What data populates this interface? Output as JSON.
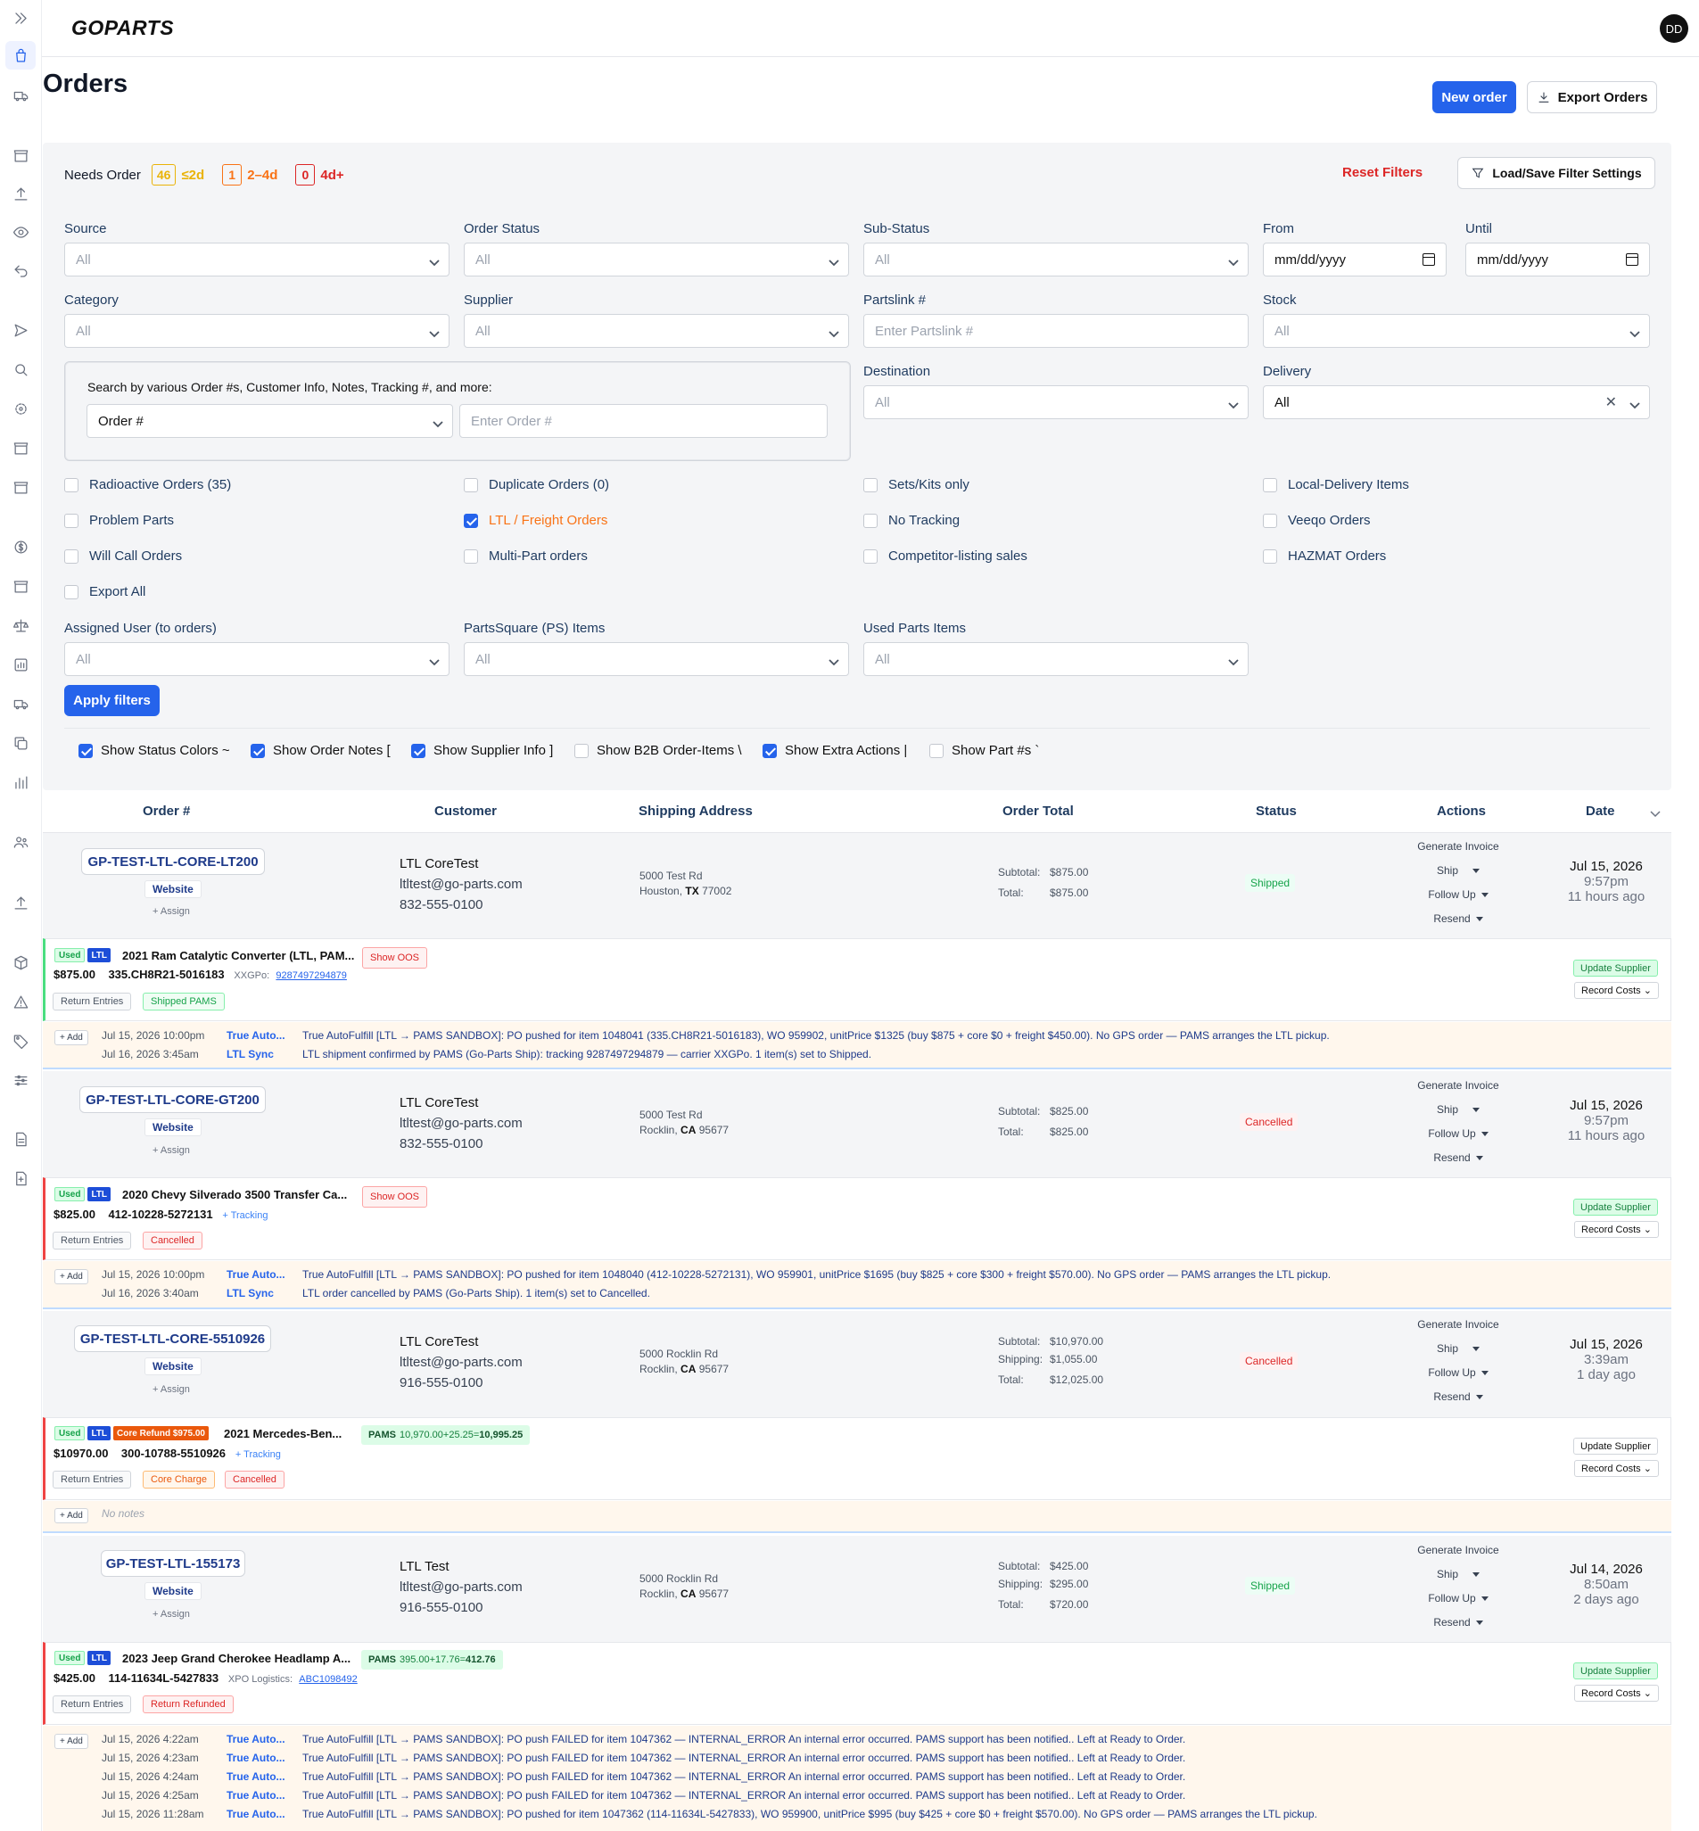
{
  "app": {
    "logo": "GOPARTS",
    "avatar_initials": "DD"
  },
  "page": {
    "title": "Orders",
    "new_order": "New order",
    "export_orders": "Export Orders"
  },
  "needs_order": {
    "label": "Needs Order",
    "counts": [
      {
        "count": "46",
        "range": "≤2d",
        "color": "#eab308"
      },
      {
        "count": "1",
        "range": "2–4d",
        "color": "#f97316"
      },
      {
        "count": "0",
        "range": "4d+",
        "color": "#dc2626"
      }
    ]
  },
  "filters": {
    "reset": "Reset Filters",
    "load_save": "Load/Save Filter Settings",
    "source": {
      "label": "Source",
      "value": "All"
    },
    "order_status": {
      "label": "Order Status",
      "value": "All"
    },
    "sub_status": {
      "label": "Sub-Status",
      "value": "All"
    },
    "from": {
      "label": "From",
      "value": "mm/dd/yyyy"
    },
    "until": {
      "label": "Until",
      "value": "mm/dd/yyyy"
    },
    "category": {
      "label": "Category",
      "value": "All"
    },
    "supplier": {
      "label": "Supplier",
      "value": "All"
    },
    "partslink": {
      "label": "Partslink #",
      "placeholder": "Enter Partslink #"
    },
    "stock": {
      "label": "Stock",
      "value": "All"
    },
    "search": {
      "label": "Search by various Order #s, Customer Info, Notes, Tracking #, and more:",
      "type": "Order #",
      "placeholder": "Enter Order #"
    },
    "destination": {
      "label": "Destination",
      "value": "All"
    },
    "delivery": {
      "label": "Delivery",
      "value": "All"
    },
    "checkboxes": [
      {
        "label": "Radioactive Orders (35)",
        "checked": false
      },
      {
        "label": "Duplicate Orders (0)",
        "checked": false
      },
      {
        "label": "Sets/Kits only",
        "checked": false
      },
      {
        "label": "Local-Delivery Items",
        "checked": false
      },
      {
        "label": "Problem Parts",
        "checked": false
      },
      {
        "label": "LTL / Freight Orders",
        "checked": true
      },
      {
        "label": "No Tracking",
        "checked": false
      },
      {
        "label": "Veeqo Orders",
        "checked": false
      },
      {
        "label": "Will Call Orders",
        "checked": false
      },
      {
        "label": "Multi-Part orders",
        "checked": false
      },
      {
        "label": "Competitor-listing sales",
        "checked": false
      },
      {
        "label": "HAZMAT Orders",
        "checked": false
      },
      {
        "label": "Export All",
        "checked": false
      }
    ],
    "assigned_user": {
      "label": "Assigned User (to orders)",
      "value": "All"
    },
    "partssquare": {
      "label": "PartsSquare (PS) Items",
      "value": "All"
    },
    "used_parts": {
      "label": "Used Parts Items",
      "value": "All"
    },
    "apply": "Apply filters"
  },
  "toggles": [
    {
      "label": "Show Status Colors ~",
      "checked": true
    },
    {
      "label": "Show Order Notes [",
      "checked": true
    },
    {
      "label": "Show Supplier Info ]",
      "checked": true
    },
    {
      "label": "Show B2B Order-Items \\",
      "checked": false
    },
    {
      "label": "Show Extra Actions |",
      "checked": true
    },
    {
      "label": "Show Part #s `",
      "checked": false
    }
  ],
  "table": {
    "headers": [
      "Order #",
      "Customer",
      "Shipping Address",
      "Order Total",
      "Status",
      "Actions",
      "Date"
    ]
  },
  "actions": {
    "generate_invoice": "Generate Invoice",
    "ship": "Ship",
    "follow_up": "Follow Up",
    "resend": "Resend",
    "assign": "+ Assign",
    "return_entries": "Return Entries",
    "update_supplier": "Update Supplier",
    "record_costs": "Record Costs ⌄",
    "add": "+ Add",
    "show_oos": "Show OOS",
    "tracking": "+ Tracking",
    "used": "Used",
    "ltl": "LTL",
    "subtotal": "Subtotal:",
    "shipping": "Shipping:",
    "total": "Total:",
    "no_notes": "No notes"
  },
  "orders": [
    {
      "number": "GP-TEST-LTL-CORE-LT200",
      "source": "Website",
      "customer": "LTL CoreTest",
      "email": "ltltest@go-parts.com",
      "phone": "832-555-0100",
      "addr1": "5000 Test Rd",
      "city": "Houston,",
      "state": "TX",
      "zip": "77002",
      "subtotal": "$875.00",
      "total": "$875.00",
      "status": "Shipped",
      "date": "Jul 15, 2026",
      "time": "9:57pm",
      "ago": "11 hours ago",
      "item_title": "2021 Ram Catalytic Converter (LTL, PAM...",
      "price": "$875.00",
      "part": "335.CH8R21-5016183",
      "carrier": "XXGPo:",
      "tracking_no": "9287497294879",
      "chip": "Shipped PAMS",
      "notes": [
        {
          "date": "Jul 15, 2026  10:00pm",
          "author": "True Auto...",
          "text": "True AutoFulfill [LTL → PAMS SANDBOX]: PO pushed for item 1048041 (335.CH8R21-5016183), WO 959902, unitPrice $1325 (buy $875 + core $0 + freight $450.00). No GPS order — PAMS arranges the LTL pickup."
        },
        {
          "date": "Jul 16, 2026  3:45am",
          "author": "LTL Sync",
          "text": "LTL shipment confirmed by PAMS (Go-Parts Ship): tracking 9287497294879 — carrier XXGPo. 1 item(s) set to Shipped."
        }
      ]
    },
    {
      "number": "GP-TEST-LTL-CORE-GT200",
      "source": "Website",
      "customer": "LTL CoreTest",
      "email": "ltltest@go-parts.com",
      "phone": "832-555-0100",
      "addr1": "5000 Test Rd",
      "city": "Rocklin,",
      "state": "CA",
      "zip": "95677",
      "subtotal": "$825.00",
      "total": "$825.00",
      "status": "Cancelled",
      "date": "Jul 15, 2026",
      "time": "9:57pm",
      "ago": "11 hours ago",
      "item_title": "2020 Chevy Silverado 3500 Transfer Ca...",
      "price": "$825.00",
      "part": "412-10228-5272131",
      "chip": "Cancelled",
      "notes": [
        {
          "date": "Jul 15, 2026  10:00pm",
          "author": "True Auto...",
          "text": "True AutoFulfill [LTL → PAMS SANDBOX]: PO pushed for item 1048040 (412-10228-5272131), WO 959901, unitPrice $1695 (buy $825 + core $300 + freight $570.00). No GPS order — PAMS arranges the LTL pickup."
        },
        {
          "date": "Jul 16, 2026  3:40am",
          "author": "LTL Sync",
          "text": "LTL order cancelled by PAMS (Go-Parts Ship). 1 item(s) set to Cancelled."
        }
      ]
    },
    {
      "number": "GP-TEST-LTL-CORE-5510926",
      "source": "Website",
      "customer": "LTL CoreTest",
      "email": "ltltest@go-parts.com",
      "phone": "916-555-0100",
      "addr1": "5000 Rocklin Rd",
      "city": "Rocklin,",
      "state": "CA",
      "zip": "95677",
      "subtotal": "$10,970.00",
      "shipping": "$1,055.00",
      "total": "$12,025.00",
      "status": "Cancelled",
      "date": "Jul 15, 2026",
      "time": "3:39am",
      "ago": "1 day ago",
      "core_refund": "Core Refund $975.00",
      "item_title": "2021 Mercedes-Ben...",
      "pams_label": "PAMS",
      "pams_expr": "10,970.00+25.25=",
      "pams_total": "10,995.25",
      "price": "$10970.00",
      "part": "300-10788-5510926",
      "chip_core": "Core Charge",
      "chip": "Cancelled"
    },
    {
      "number": "GP-TEST-LTL-155173",
      "source": "Website",
      "customer": "LTL Test",
      "email": "ltltest@go-parts.com",
      "phone": "916-555-0100",
      "addr1": "5000 Rocklin Rd",
      "city": "Rocklin,",
      "state": "CA",
      "zip": "95677",
      "subtotal": "$425.00",
      "shipping": "$295.00",
      "total": "$720.00",
      "status": "Shipped",
      "date": "Jul 14, 2026",
      "time": "8:50am",
      "ago": "2 days ago",
      "item_title": "2023 Jeep Grand Cherokee Headlamp A...",
      "pams_label": "PAMS",
      "pams_expr": "395.00+17.76=",
      "pams_total": "412.76",
      "price": "$425.00",
      "part": "114-11634L-5427833",
      "carrier": "XPO Logistics:",
      "tracking_no": "ABC1098492",
      "chip": "Return Refunded",
      "notes": [
        {
          "date": "Jul 15, 2026  4:22am",
          "author": "True Auto...",
          "text": "True AutoFulfill [LTL → PAMS SANDBOX]: PO push FAILED for item 1047362 — INTERNAL_ERROR An internal error occurred. PAMS support has been notified.. Left at Ready to Order."
        },
        {
          "date": "Jul 15, 2026  4:23am",
          "author": "True Auto...",
          "text": "True AutoFulfill [LTL → PAMS SANDBOX]: PO push FAILED for item 1047362 — INTERNAL_ERROR An internal error occurred. PAMS support has been notified.. Left at Ready to Order."
        },
        {
          "date": "Jul 15, 2026  4:24am",
          "author": "True Auto...",
          "text": "True AutoFulfill [LTL → PAMS SANDBOX]: PO push FAILED for item 1047362 — INTERNAL_ERROR An internal error occurred. PAMS support has been notified.. Left at Ready to Order."
        },
        {
          "date": "Jul 15, 2026  4:25am",
          "author": "True Auto...",
          "text": "True AutoFulfill [LTL → PAMS SANDBOX]: PO push FAILED for item 1047362 — INTERNAL_ERROR An internal error occurred. PAMS support has been notified.. Left at Ready to Order."
        },
        {
          "date": "Jul 15, 2026  11:28am",
          "author": "True Auto...",
          "text": "True AutoFulfill [LTL → PAMS SANDBOX]: PO pushed for item 1047362 (114-11634L-5427833), WO 959900, unitPrice $995 (buy $425 + core $0 + freight $570.00). No GPS order — PAMS arranges the LTL pickup."
        }
      ]
    }
  ]
}
